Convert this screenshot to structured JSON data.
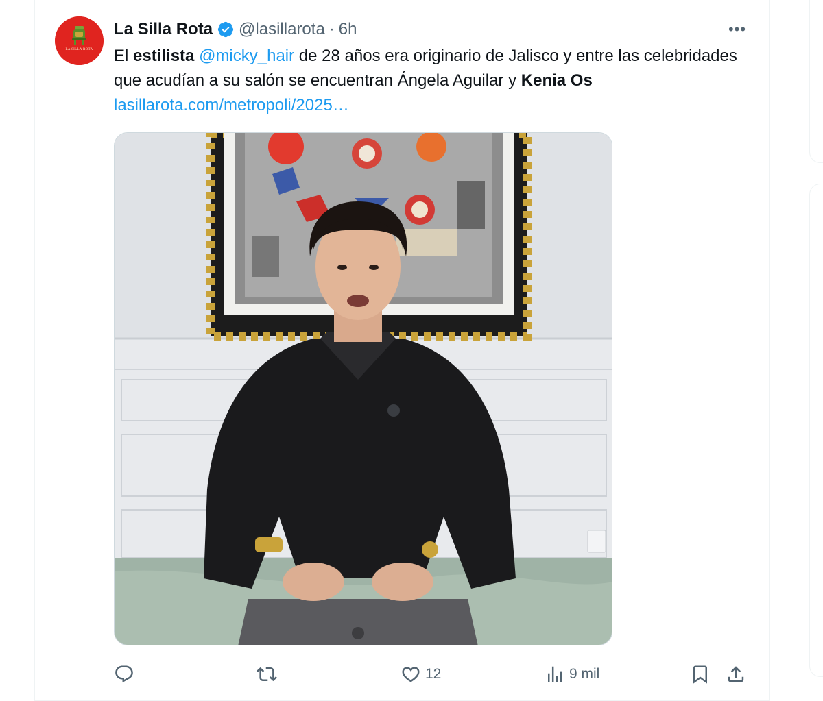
{
  "tweet": {
    "author_name": "La Silla Rota",
    "handle": "@lasillarota",
    "separator": "·",
    "time": "6h",
    "more_label": "•••",
    "avatar_text": "LA SILLA ROTA",
    "text": {
      "t1": "El ",
      "b1": "estilista",
      "t2": " ",
      "mention": "@micky_hair",
      "t3": " de 28 años era originario de Jalisco y entre las celebridades que acudían a su salón se encuentran Ángela Aguilar y ",
      "b2": "Kenia Os",
      "t4": " ",
      "link": "lasillarota.com/metropoli/2025…"
    }
  },
  "actions": {
    "reply_count": "",
    "retweet_count": "",
    "like_count": "12",
    "views_count": "9 mil"
  },
  "colors": {
    "accent": "#1d9bf0",
    "secondary_text": "#536471",
    "avatar_bg": "#e0241f"
  },
  "icons": [
    "verified-badge-icon",
    "more-icon",
    "reply-icon",
    "retweet-icon",
    "like-icon",
    "views-icon",
    "bookmark-icon",
    "share-icon"
  ]
}
